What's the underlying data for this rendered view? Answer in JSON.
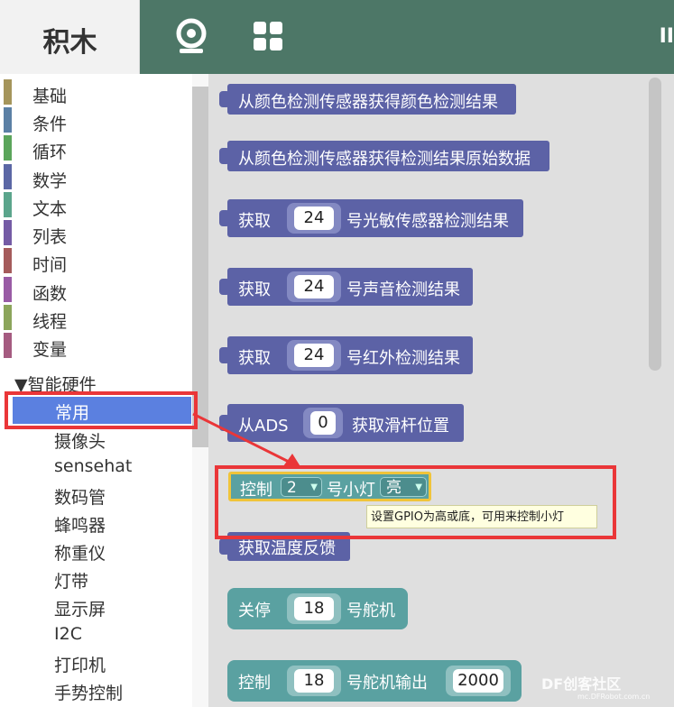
{
  "header": {
    "title": "积木",
    "edge_text": "II"
  },
  "sidebar": {
    "categories": [
      {
        "label": "基础",
        "color": "#a5955b"
      },
      {
        "label": "条件",
        "color": "#5b80a5"
      },
      {
        "label": "循环",
        "color": "#5ba55b"
      },
      {
        "label": "数学",
        "color": "#5b67a5"
      },
      {
        "label": "文本",
        "color": "#5ba58c"
      },
      {
        "label": "列表",
        "color": "#745ba5"
      },
      {
        "label": "时间",
        "color": "#a55b5b"
      },
      {
        "label": "函数",
        "color": "#995ba5"
      },
      {
        "label": "线程",
        "color": "#8ca55b"
      },
      {
        "label": "变量",
        "color": "#a55b80"
      }
    ],
    "group": "▼智能硬件",
    "selected": "常用",
    "subitems": [
      "摄像头",
      "sensehat",
      "数码管",
      "蜂鸣器",
      "称重仪",
      "灯带",
      "显示屏",
      "I2C",
      "打印机",
      "手势控制"
    ]
  },
  "blocks": {
    "b1": "从颜色检测传感器获得颜色检测结果",
    "b2": "从颜色检测传感器获得检测结果原始数据",
    "b3": {
      "prefix": "获取",
      "num": "24",
      "suffix": "号光敏传感器检测结果"
    },
    "b4": {
      "prefix": "获取",
      "num": "24",
      "suffix": "号声音检测结果"
    },
    "b5": {
      "prefix": "获取",
      "num": "24",
      "suffix": "号红外检测结果"
    },
    "b6": {
      "prefix": "从ADS",
      "num": "0",
      "suffix": "获取滑杆位置"
    },
    "b7": {
      "prefix": "控制",
      "dd1": "2",
      "mid": "号小灯",
      "dd2": "亮"
    },
    "b8": "获取温度反馈",
    "b9": {
      "prefix": "关停",
      "num": "18",
      "suffix": "号舵机"
    },
    "b10": {
      "prefix": "控制",
      "num": "18",
      "suffix": "号舵机输出",
      "num2": "2000"
    }
  },
  "tooltip": "设置GPIO为高或底，可用来控制小灯",
  "watermark": {
    "main": "DF创客社区",
    "sub": "mc.DFRobot.com.cn"
  }
}
